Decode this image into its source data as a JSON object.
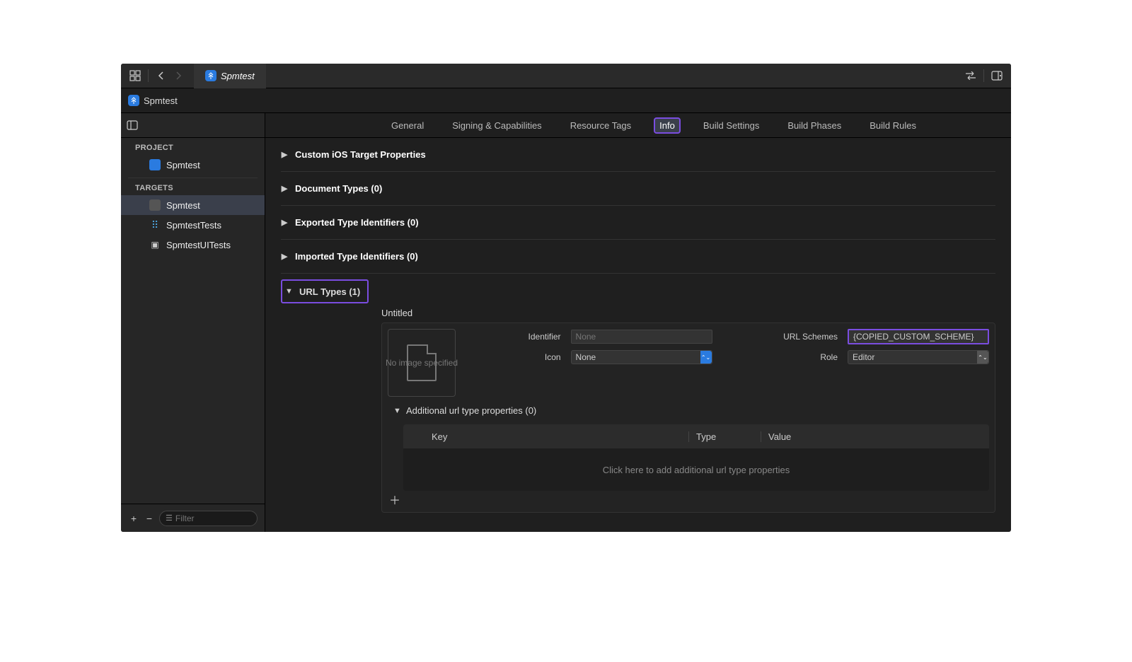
{
  "toolbar": {
    "tab_title": "Spmtest"
  },
  "breadcrumb": {
    "project": "Spmtest"
  },
  "sidebar": {
    "project_label": "PROJECT",
    "project_item": "Spmtest",
    "targets_label": "TARGETS",
    "targets": [
      {
        "label": "Spmtest"
      },
      {
        "label": "SpmtestTests"
      },
      {
        "label": "SpmtestUITests"
      }
    ],
    "filter_placeholder": "Filter"
  },
  "tabs": [
    "General",
    "Signing & Capabilities",
    "Resource Tags",
    "Info",
    "Build Settings",
    "Build Phases",
    "Build Rules"
  ],
  "sections": {
    "s0": "Custom iOS Target Properties",
    "s1": "Document Types (0)",
    "s2": "Exported Type Identifiers (0)",
    "s3": "Imported Type Identifiers (0)",
    "url_types": "URL Types (1)"
  },
  "url_type_detail": {
    "title": "Untitled",
    "empty_image": "No image specified",
    "identifier_label": "Identifier",
    "identifier_placeholder": "None",
    "icon_label": "Icon",
    "icon_value": "None",
    "url_schemes_label": "URL Schemes",
    "url_schemes_value": "{COPIED_CUSTOM_SCHEME}",
    "role_label": "Role",
    "role_value": "Editor",
    "additional_props_label": "Additional url type properties (0)",
    "table": {
      "key": "Key",
      "type": "Type",
      "value": "Value",
      "empty": "Click here to add additional url type properties"
    }
  }
}
